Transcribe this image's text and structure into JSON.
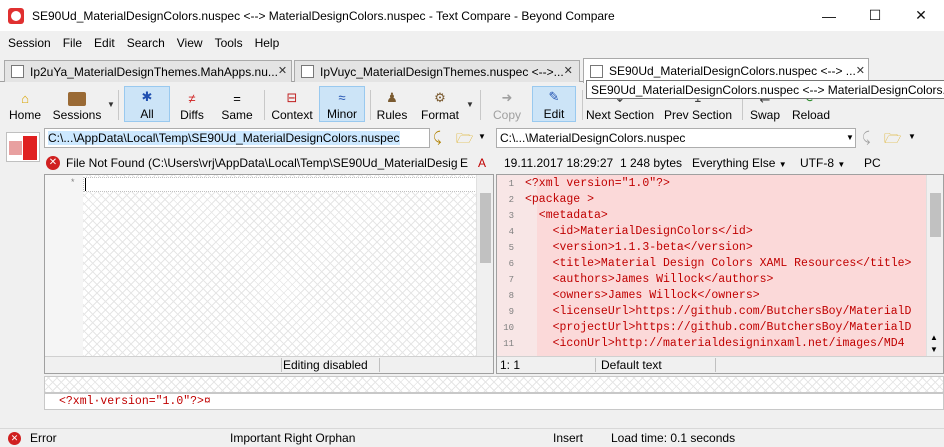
{
  "window": {
    "title": "SE90Ud_MaterialDesignColors.nuspec <--> MaterialDesignColors.nuspec - Text Compare - Beyond Compare"
  },
  "menu": [
    "Session",
    "File",
    "Edit",
    "Search",
    "View",
    "Tools",
    "Help"
  ],
  "tabs": [
    {
      "label": "Ip2uYa_MaterialDesignThemes.MahApps.nu..."
    },
    {
      "label": "IpVuyc_MaterialDesignThemes.nuspec <-->..."
    },
    {
      "label": "SE90Ud_MaterialDesignColors.nuspec <--> ..."
    }
  ],
  "tooltip": "SE90Ud_MaterialDesignColors.nuspec <--> MaterialDesignColors.nuspec",
  "toolbar": {
    "home": "Home",
    "sessions": "Sessions",
    "all": "All",
    "diffs": "Diffs",
    "same": "Same",
    "context": "Context",
    "minor": "Minor",
    "rules": "Rules",
    "format": "Format",
    "copy": "Copy",
    "edit": "Edit",
    "next_section": "Next Section",
    "prev_section": "Prev Section",
    "swap": "Swap",
    "reload": "Reload"
  },
  "left": {
    "path": "C:\\...\\AppData\\Local\\Temp\\SE90Ud_MaterialDesignColors.nuspec",
    "error": "File Not Found (C:\\Users\\vrj\\AppData\\Local\\Temp\\SE90Ud_MaterialDesig",
    "flag_e": "E",
    "flag_a": "A",
    "status": "Editing disabled"
  },
  "right": {
    "path": "C:\\...\\MaterialDesignColors.nuspec",
    "date": "19.11.2017 18:29:27",
    "size": "1 248 bytes",
    "filter": "Everything Else",
    "encoding": "UTF-8",
    "line_end": "PC",
    "position": "1: 1",
    "status": "Default text",
    "lines": [
      {
        "n": "1",
        "t": "<?xml version=\"1.0\"?>"
      },
      {
        "n": "2",
        "t": "<package >"
      },
      {
        "n": "3",
        "t": "  <metadata>"
      },
      {
        "n": "4",
        "t": "    <id>MaterialDesignColors</id>"
      },
      {
        "n": "5",
        "t": "    <version>1.1.3-beta</version>"
      },
      {
        "n": "6",
        "t": "    <title>Material Design Colors XAML Resources</title>"
      },
      {
        "n": "7",
        "t": "    <authors>James Willock</authors>"
      },
      {
        "n": "8",
        "t": "    <owners>James Willock</owners>"
      },
      {
        "n": "9",
        "t": "    <licenseUrl>https://github.com/ButchersBoy/MaterialD"
      },
      {
        "n": "10",
        "t": "    <projectUrl>https://github.com/ButchersBoy/MaterialD"
      },
      {
        "n": "11",
        "t": "    <iconUrl>http://materialdesigninxaml.net/images/MD4"
      }
    ]
  },
  "detail_line": "<?xml·version=\"1.0\"?>¤",
  "statusbar": {
    "error": "Error",
    "orphan": "Important Right Orphan",
    "insert": "Insert",
    "load": "Load time: 0.1 seconds"
  }
}
